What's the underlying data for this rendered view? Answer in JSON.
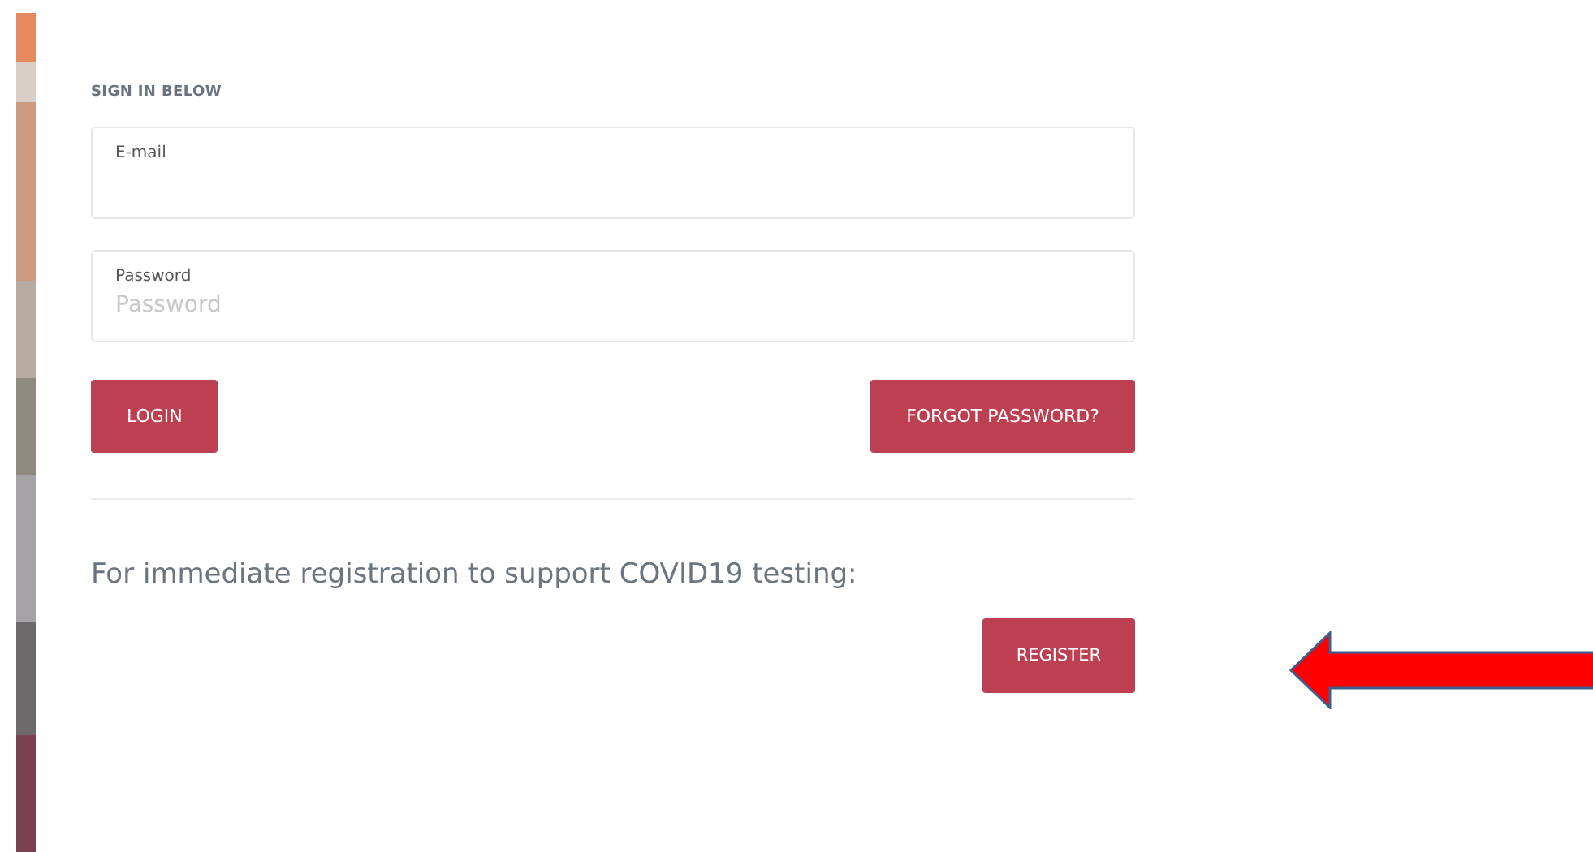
{
  "heading": "SIGN IN BELOW",
  "fields": [
    {
      "label": "E-mail"
    },
    {
      "label": "Password",
      "placeholder": "Password"
    }
  ],
  "actions": [
    {
      "label": "LOGIN"
    },
    {
      "label": "FORGOT PASSWORD?"
    }
  ],
  "register_prompt": "For immediate registration to support COVID19 testing:",
  "register_button": "REGISTER"
}
